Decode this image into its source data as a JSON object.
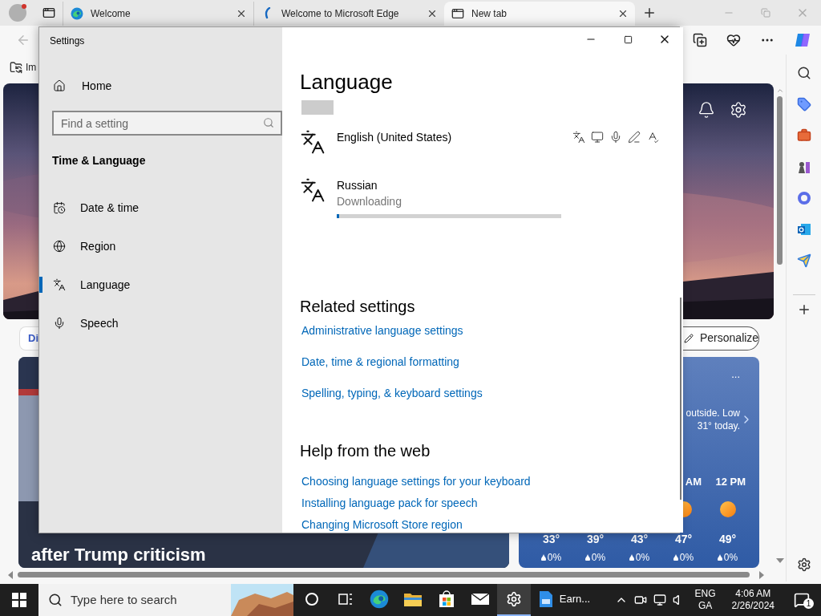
{
  "browser": {
    "tabs": [
      {
        "title": "Welcome",
        "kind": "edge",
        "selected": false
      },
      {
        "title": "Welcome to Microsoft Edge",
        "kind": "swirl",
        "selected": false
      },
      {
        "title": "New tab",
        "kind": "newtab",
        "selected": true
      }
    ],
    "favorites": [
      {
        "label": "Im"
      }
    ],
    "page": {
      "chip": "Di",
      "personalize": "Personalize",
      "headline": "after Trump criticism",
      "weather": {
        "more": "...",
        "summary": [
          "outside. Low",
          "31° today."
        ],
        "hours": [
          {
            "temp": "33°",
            "precip": "0%"
          },
          {
            "temp": "39°",
            "precip": "0%"
          },
          {
            "temp": "43°",
            "precip": "0%"
          },
          {
            "time": "AM",
            "sunny": true,
            "temp": "47°",
            "precip": "0%"
          },
          {
            "time": "12 PM",
            "sunny": true,
            "temp": "49°",
            "precip": "0%"
          }
        ]
      }
    }
  },
  "settings": {
    "title": "Settings",
    "home": "Home",
    "search": {
      "placeholder": "Find a setting"
    },
    "section": "Time & Language",
    "nav": [
      {
        "label": "Date & time",
        "kind": "calendar",
        "selected": false
      },
      {
        "label": "Region",
        "kind": "globe",
        "selected": false
      },
      {
        "label": "Language",
        "kind": "language",
        "selected": true
      },
      {
        "label": "Speech",
        "kind": "mic",
        "selected": false
      }
    ],
    "heading": "Language",
    "languages": [
      {
        "name": "English (United States)"
      },
      {
        "name": "Russian",
        "status": "Downloading",
        "level": 0.01
      }
    ],
    "related": {
      "title": "Related settings",
      "links": [
        "Administrative language settings",
        "Date, time & regional formatting",
        "Spelling, typing, & keyboard settings"
      ]
    },
    "help": {
      "title": "Help from the web",
      "links": [
        "Choosing language settings for your keyboard",
        "Installing language pack for speech",
        "Changing Microsoft Store region"
      ]
    }
  },
  "taskbar": {
    "search": {
      "placeholder": "Type here to search"
    },
    "apps": [
      {
        "kind": "cortana",
        "selected": false
      },
      {
        "kind": "taskview",
        "selected": false
      },
      {
        "kind": "edge",
        "selected": false
      },
      {
        "kind": "folder",
        "selected": false
      },
      {
        "kind": "store",
        "selected": false
      },
      {
        "kind": "mail",
        "selected": false
      },
      {
        "kind": "gear",
        "selected": true
      },
      {
        "kind": "document",
        "label": "Earn...",
        "selected": false
      }
    ],
    "language": [
      "ENG",
      "GA"
    ],
    "time": "4:06 AM",
    "date": "2/26/2024",
    "notifications": "1"
  }
}
